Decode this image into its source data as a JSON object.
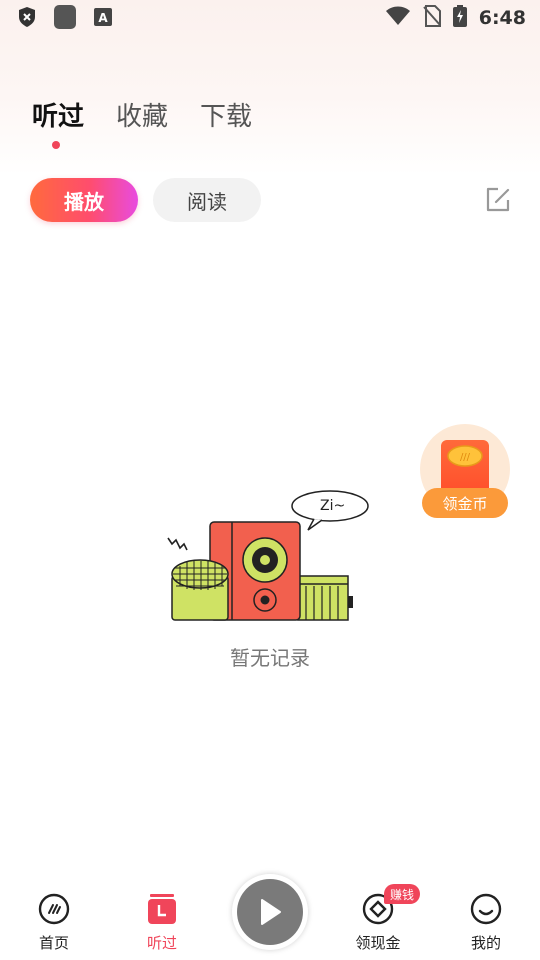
{
  "status_bar": {
    "time": "6:48"
  },
  "main_tabs": [
    {
      "label": "听过",
      "active": true
    },
    {
      "label": "收藏",
      "active": false
    },
    {
      "label": "下载",
      "active": false
    }
  ],
  "sub_tabs": [
    {
      "label": "播放",
      "active": true
    },
    {
      "label": "阅读",
      "active": false
    }
  ],
  "empty_state": {
    "bubble_text": "Zi~",
    "message": "暂无记录"
  },
  "floating_reward": {
    "label": "领金币"
  },
  "bottom_nav": {
    "items": [
      {
        "label": "首页",
        "icon": "home-icon",
        "active": false
      },
      {
        "label": "听过",
        "icon": "history-icon",
        "active": true
      },
      {
        "label": "领现金",
        "icon": "cash-icon",
        "active": false,
        "badge": "赚钱"
      },
      {
        "label": "我的",
        "icon": "profile-icon",
        "active": false
      }
    ],
    "play_icon": "play-icon"
  },
  "colors": {
    "accent": "#f0455a",
    "reward": "#fb9a3a"
  }
}
